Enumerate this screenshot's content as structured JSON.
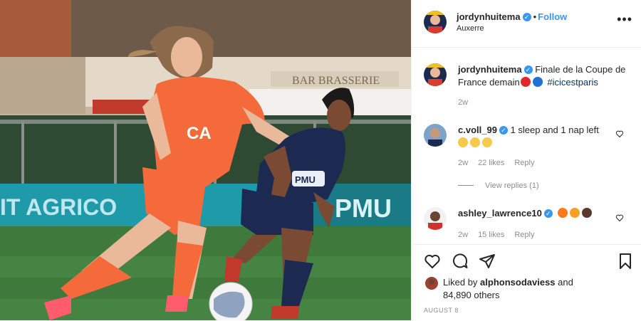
{
  "post": {
    "author": "jordynhuitema",
    "follow_label": "Follow",
    "separator": "•",
    "location": "Auxerre",
    "more_label": "•••",
    "caption": {
      "username": "jordynhuitema",
      "text": "Finale de la Coupe de France demain",
      "hashtag": "#icicestparis",
      "time": "2w"
    },
    "comments": [
      {
        "username": "c.voll_99",
        "text": "1 sleep and 1 nap left",
        "time": "2w",
        "likes": "22 likes",
        "reply_label": "Reply",
        "view_replies": "View replies (1)"
      },
      {
        "username": "ashley_lawrence10",
        "text": "",
        "time": "2w",
        "likes": "15 likes",
        "reply_label": "Reply"
      }
    ],
    "liked_by": {
      "prefix": "Liked by",
      "username": "alphonsodaviess",
      "conj": "and",
      "others": "84,890 others"
    },
    "date": "AUGUST 8"
  },
  "photo_text": {
    "banner_left": "IT AGRICO",
    "banner_right": "PMU",
    "building_sign": "BAR BRASSERIE",
    "shirt_sponsor_left": "CA",
    "shirt_sponsor_right": "PMU"
  },
  "colors": {
    "accent": "#3897f0",
    "orange_kit": "#f56a3a",
    "navy_kit": "#1c2a52",
    "grass": "#3f7a3c"
  },
  "icons": {
    "verified": "verified-badge-icon",
    "like": "heart-icon",
    "comment": "comment-icon",
    "share": "paper-plane-icon",
    "save": "bookmark-icon"
  }
}
